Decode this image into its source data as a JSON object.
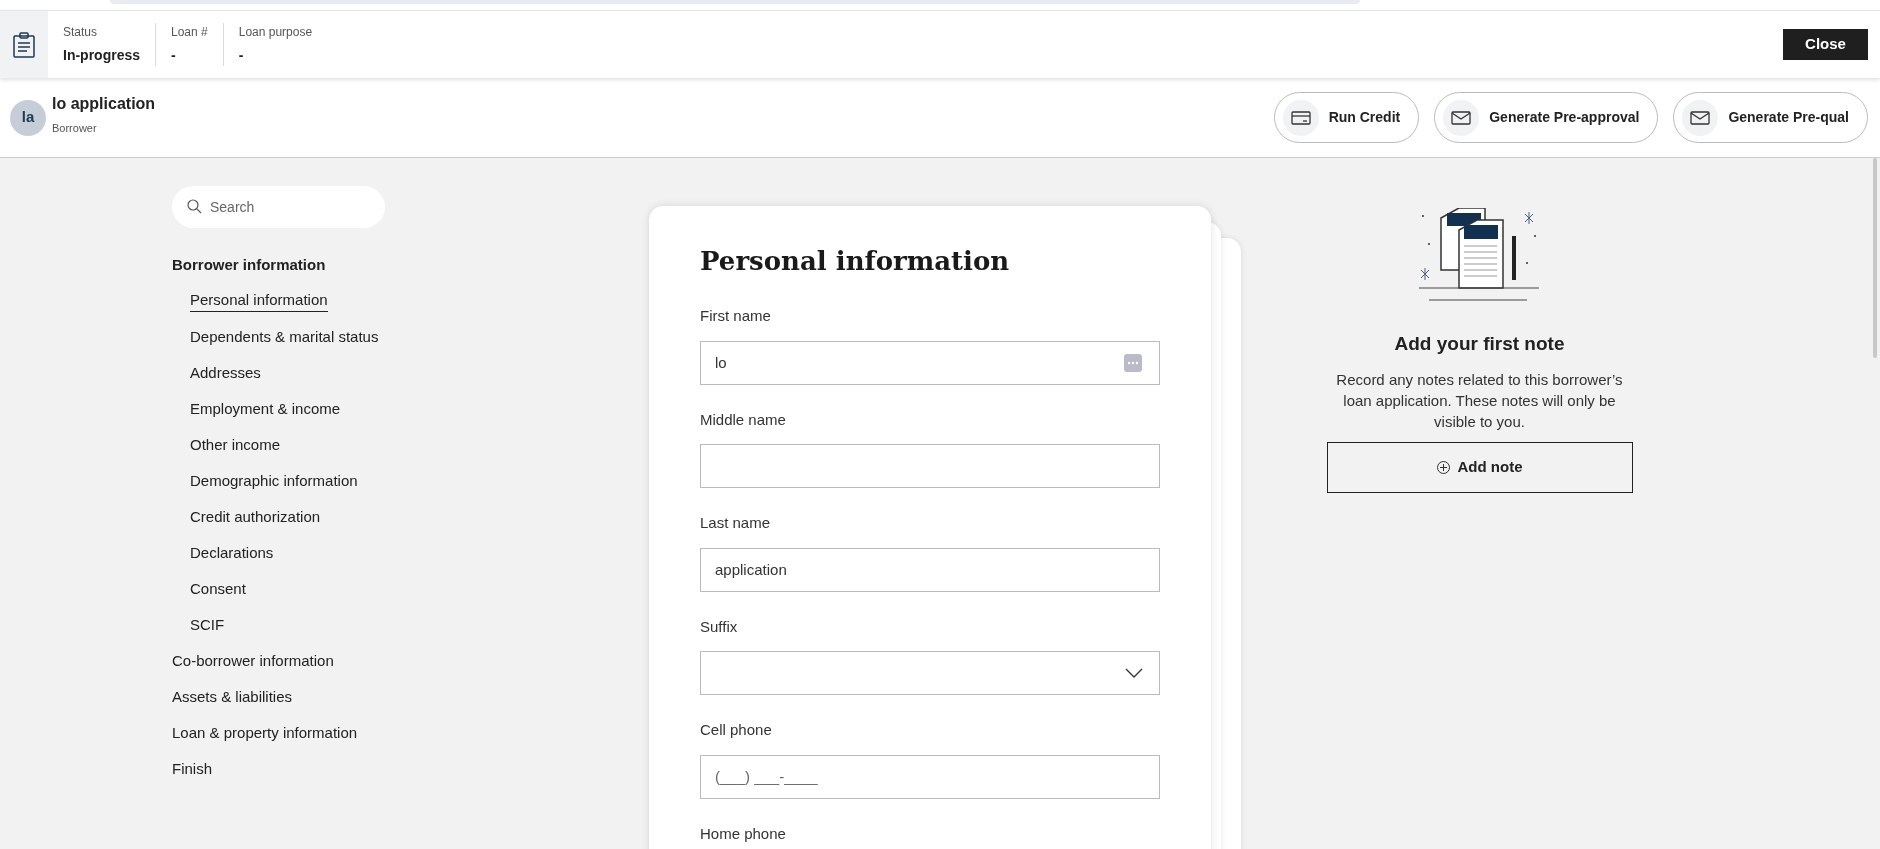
{
  "header": {
    "fields": [
      {
        "label": "Status",
        "value": "In-progress"
      },
      {
        "label": "Loan #",
        "value": "-"
      },
      {
        "label": "Loan purpose",
        "value": "-"
      }
    ],
    "close_button": "Close"
  },
  "borrower": {
    "initials": "la",
    "name": "lo application",
    "role": "Borrower"
  },
  "actions": [
    {
      "kind": "card",
      "label": "Run Credit"
    },
    {
      "kind": "mail",
      "label": "Generate Pre-approval"
    },
    {
      "kind": "mail",
      "label": "Generate Pre-qual"
    }
  ],
  "sidebar": {
    "search": {
      "placeholder": "Search"
    },
    "items": [
      {
        "label": "Borrower information",
        "selected": true,
        "children": [
          {
            "label": "Personal information",
            "selected": true
          },
          {
            "label": "Dependents & marital status",
            "selected": false
          },
          {
            "label": "Addresses",
            "selected": false
          },
          {
            "label": "Employment & income",
            "selected": false
          },
          {
            "label": "Other income",
            "selected": false
          },
          {
            "label": "Demographic information",
            "selected": false
          },
          {
            "label": "Credit authorization",
            "selected": false
          },
          {
            "label": "Declarations",
            "selected": false
          },
          {
            "label": "Consent",
            "selected": false
          },
          {
            "label": "SCIF",
            "selected": false
          }
        ]
      },
      {
        "label": "Co-borrower information",
        "selected": false
      },
      {
        "label": "Assets & liabilities",
        "selected": false
      },
      {
        "label": "Loan & property information",
        "selected": false
      },
      {
        "label": "Finish",
        "selected": false
      }
    ]
  },
  "form": {
    "title": "Personal information",
    "fields": [
      {
        "kind": "text",
        "label": "First name",
        "value": "lo",
        "autofill": true
      },
      {
        "kind": "text",
        "label": "Middle name"
      },
      {
        "kind": "text",
        "label": "Last name",
        "value": "application"
      },
      {
        "kind": "select",
        "label": "Suffix"
      },
      {
        "kind": "text",
        "label": "Cell phone",
        "placeholder": "(___) ___-____"
      },
      {
        "kind": "text",
        "label": "Home phone"
      }
    ]
  },
  "notes": {
    "title": "Add your first note",
    "text": "Record any notes related to this borrower’s loan application. These notes will only be visible to you.",
    "button": "Add note"
  }
}
